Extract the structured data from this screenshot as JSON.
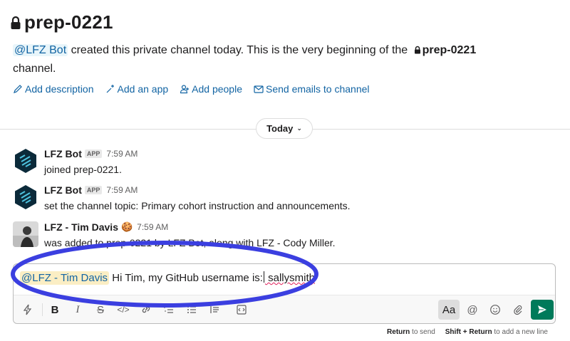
{
  "channel": {
    "name": "prep-0221",
    "intro_mention": "@LFZ Bot",
    "intro_text": " created this private channel today. This is the very beginning of the ",
    "intro_channel": "prep-0221",
    "intro_end": "channel."
  },
  "actions": [
    {
      "label": "Add description",
      "icon": "pencil-icon"
    },
    {
      "label": "Add an app",
      "icon": "sparkle-icon"
    },
    {
      "label": "Add people",
      "icon": "add-person-icon"
    },
    {
      "label": "Send emails to channel",
      "icon": "email-icon"
    }
  ],
  "date_divider": {
    "label": "Today"
  },
  "messages": [
    {
      "name": "LFZ Bot",
      "badge": "APP",
      "time": "7:59 AM",
      "text": "joined prep-0221."
    },
    {
      "name": "LFZ Bot",
      "badge": "APP",
      "time": "7:59 AM",
      "text": "set the channel topic: Primary cohort instruction and announcements."
    },
    {
      "name": "LFZ - Tim Davis",
      "emoji": "🍪",
      "time": "7:59 AM",
      "text": "was added to prep-0221 by LFZ Bot, along with LFZ - Cody Miller."
    }
  ],
  "composer": {
    "mention": "@LFZ - Tim Davis",
    "text_before": " Hi Tim, my GitHub username is:",
    "text_after": " sallysmith",
    "format_toggle": "Aa"
  },
  "hints": {
    "return_key": "Return",
    "return_text": " to send",
    "shift_key": "Shift + Return",
    "shift_text": " to add a new line"
  },
  "colors": {
    "link": "#1264a3",
    "send": "#007a5a",
    "annotation": "#3b3fe0",
    "mention_highlight": "#fbeec4"
  }
}
